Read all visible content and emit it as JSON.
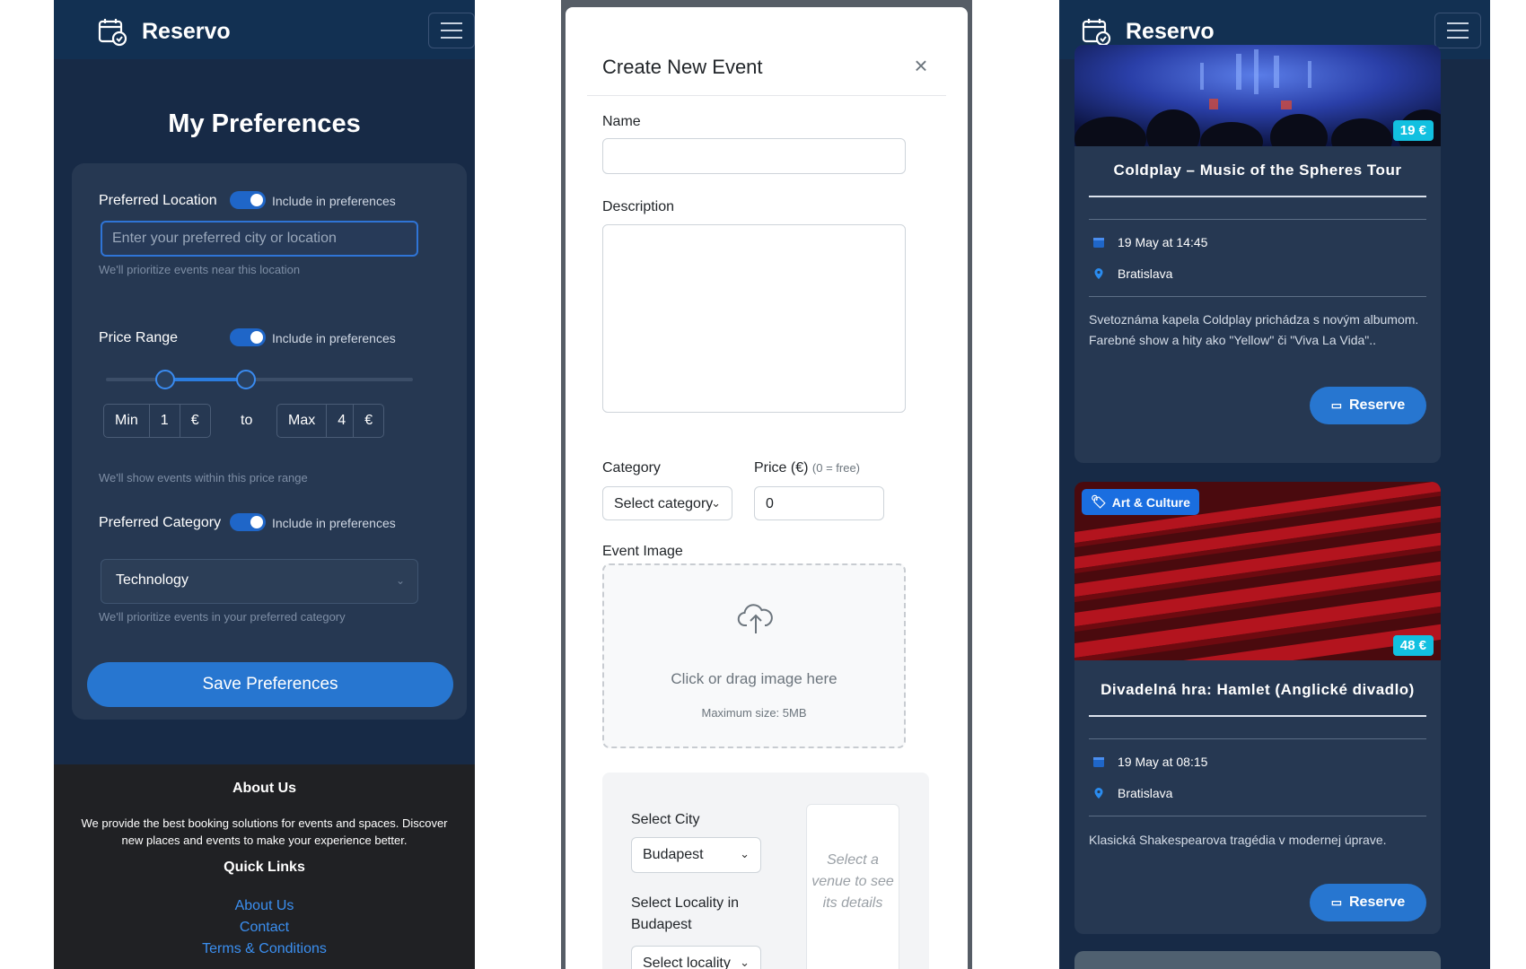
{
  "colors": {
    "navy": "#172a46",
    "nav_bar": "#123052",
    "card": "#263852",
    "accent": "#2776d0",
    "link": "#3b8ff0",
    "badge_cyan": "#12c0e0",
    "footer": "#202124"
  },
  "left_panel": {
    "brand": "Reservo",
    "page_title": "My Preferences",
    "location": {
      "label": "Preferred Location",
      "toggle_label": "Include in preferences",
      "placeholder": "Enter your preferred city or location",
      "hint": "We'll prioritize events near this location"
    },
    "price": {
      "label": "Price Range",
      "toggle_label": "Include in preferences",
      "min_label": "Min",
      "min_value": "1",
      "max_label": "Max",
      "max_value": "4",
      "currency": "€",
      "to": "to",
      "hint": "We'll show events within this price range"
    },
    "category": {
      "label": "Preferred Category",
      "toggle_label": "Include in preferences",
      "selected": "Technology",
      "hint": "We'll prioritize events in your preferred category"
    },
    "save_button": "Save Preferences",
    "footer": {
      "about_title": "About Us",
      "about_text": "We provide the best booking solutions for events and spaces. Discover new places and events to make your experience better.",
      "links_title": "Quick Links",
      "links": [
        "About Us",
        "Contact",
        "Terms & Conditions"
      ]
    }
  },
  "modal": {
    "title": "Create New Event",
    "name_label": "Name",
    "description_label": "Description",
    "category_label": "Category",
    "category_placeholder": "Select category",
    "price_label": "Price (€)",
    "price_note": "(0 = free)",
    "price_value": "0",
    "image_label": "Event Image",
    "upload_text": "Click or drag image here",
    "upload_limit": "Maximum size: 5MB",
    "city_label": "Select City",
    "city_value": "Budapest",
    "locality_label": "Select Locality in Budapest",
    "locality_placeholder": "Select locality",
    "venue_hint": "Select a venue to see its details"
  },
  "right_panel": {
    "brand": "Reservo",
    "events": [
      {
        "price": "19 €",
        "title": "Coldplay – Music of the Spheres Tour",
        "date": "19 May at 14:45",
        "location": "Bratislava",
        "description": "Svetoznáma kapela Coldplay prichádza s novým albumom. Farebné show a hity ako \"Yellow\" či \"Viva La Vida\"..",
        "button": "Reserve"
      },
      {
        "category": "Art & Culture",
        "price": "48 €",
        "title": "Divadelná hra: Hamlet (Anglické divadlo)",
        "date": "19 May at 08:15",
        "location": "Bratislava",
        "description": "Klasická Shakespearova tragédia v modernej úprave.",
        "button": "Reserve"
      }
    ]
  }
}
